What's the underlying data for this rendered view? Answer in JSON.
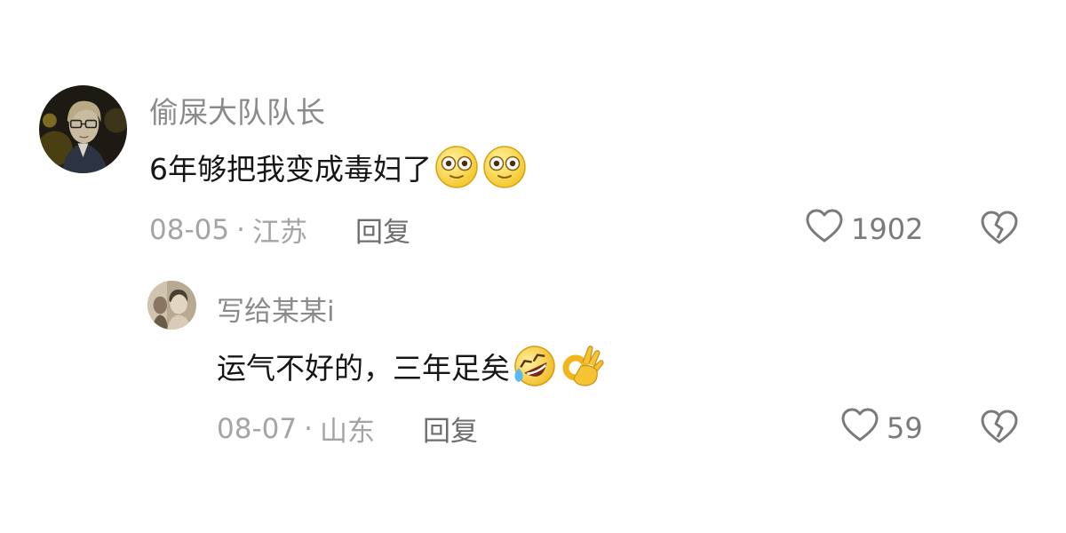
{
  "comments": [
    {
      "username": "偷屎大队队长",
      "text": "6年够把我变成毒妇了",
      "emojis": [
        "flushed-face",
        "flushed-face"
      ],
      "date": "08-05",
      "location": "江苏",
      "reply_label": "回复",
      "like_count": "1902",
      "like_icon": "heart-outline-icon",
      "dislike_icon": "broken-heart-icon"
    },
    {
      "username": "写给某某i",
      "text": "运气不好的，三年足矣",
      "emojis": [
        "rolling-on-floor-laughing",
        "ok-hand"
      ],
      "date": "08-07",
      "location": "山东",
      "reply_label": "回复",
      "like_count": "59",
      "like_icon": "heart-outline-icon",
      "dislike_icon": "broken-heart-icon"
    }
  ],
  "separator": "·",
  "colors": {
    "username": "#8a8a8a",
    "text": "#161616",
    "meta": "#a4a4a4",
    "icon": "#7a7a7a"
  }
}
